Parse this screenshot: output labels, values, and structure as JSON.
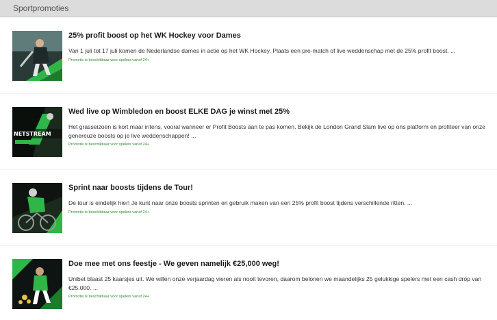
{
  "header": {
    "title": "Sportpromoties"
  },
  "promos": [
    {
      "title": "25% profit boost op het WK Hockey voor Dames",
      "description": "Van 1 juli tot 17 juli komen de Nederlandse dames in actie op het WK Hockey. Plaats een pre-match of live weddenschap met de 25% profit boost. ...",
      "availability": "Promotie is beschikbaar voor spelers vanaf 24+",
      "image": "hockey-player-image"
    },
    {
      "title": "Wed live op Wimbledon en boost ELKE DAG je winst met 25%",
      "description": "Het grasseizoen is kort maar intens, vooral wanneer er Profit Boosts aan te pas komen. Bekijk de London Grand Slam live op ons platform en profiteer van onze genereuze boosts op je live weddenschappen! ...",
      "availability": "Promotie is beschikbaar voor spelers vanaf 24+",
      "image": "tennis-stream-image",
      "image_text": "NETSTREAM"
    },
    {
      "title": "Sprint naar boosts tijdens de Tour!",
      "description": "De tour is eindelijk hier! Je kunt naar onze boosts sprinten en gebruik maken van een 25% profit boost tijdens verschillende ritten. ...",
      "availability": "Promotie is beschikbaar voor spelers vanaf 24+",
      "image": "cyclist-image"
    },
    {
      "title": "Doe mee met ons feestje - We geven namelijk €25,000 weg!",
      "description": "Unibet blaast 25 kaarsjes uit. We willen onze verjaardag vieren als nooit tevoren, daarom belonen we maandelijks 25 gelukkige spelers met een cash drop van €25.000. ...",
      "availability": "Promotie is beschikbaar voor spelers vanaf 24+",
      "image": "birthday-athletes-image"
    }
  ],
  "colors": {
    "accent_green": "#2fb548",
    "background": "#f3f3f3",
    "header": "#dcdcdc"
  }
}
